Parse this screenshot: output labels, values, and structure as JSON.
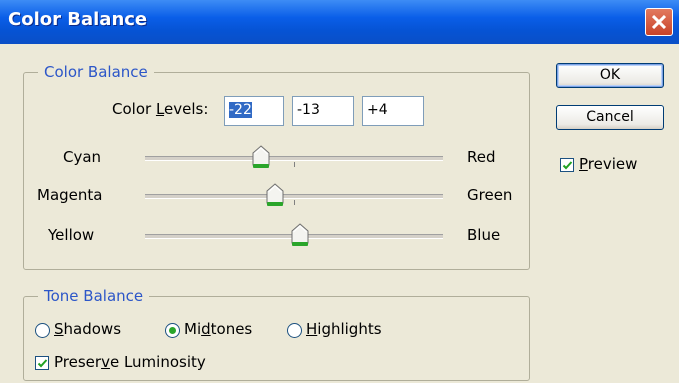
{
  "window": {
    "title": "Color Balance"
  },
  "color_balance": {
    "group_label": "Color Balance",
    "levels_label_pre": "Color ",
    "levels_label_mn": "L",
    "levels_label_post": "evels:",
    "levels": [
      "-22",
      "-13",
      "+4"
    ],
    "sliders": [
      {
        "left": "Cyan",
        "right": "Red",
        "value": -22
      },
      {
        "left": "Magenta",
        "right": "Green",
        "value": -13
      },
      {
        "left": "Yellow",
        "right": "Blue",
        "value": 4
      }
    ],
    "slider_range": [
      -100,
      100
    ]
  },
  "tone_balance": {
    "group_label": "Tone Balance",
    "options": [
      {
        "mn": "S",
        "rest": "hadows",
        "pre": "",
        "checked": false
      },
      {
        "pre": "Mi",
        "mn": "d",
        "rest": "tones",
        "checked": true
      },
      {
        "pre": "",
        "mn": "H",
        "rest": "ighlights",
        "checked": false
      }
    ],
    "preserve": {
      "pre": "Preser",
      "mn": "v",
      "rest": "e Luminosity",
      "checked": true
    }
  },
  "buttons": {
    "ok": "OK",
    "cancel": "Cancel"
  },
  "preview": {
    "mn": "P",
    "rest": "review",
    "checked": true
  },
  "colors": {
    "title_bar": "#0a5ee8",
    "group_label": "#2c56c8",
    "thumb": "#2aa52a",
    "background": "#ece9d8"
  }
}
